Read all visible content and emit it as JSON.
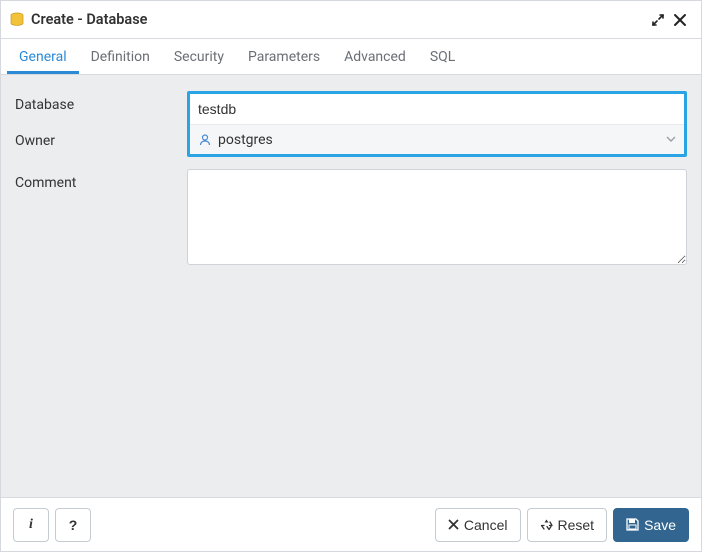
{
  "header": {
    "title": "Create - Database"
  },
  "tabs": [
    {
      "label": "General",
      "active": true
    },
    {
      "label": "Definition",
      "active": false
    },
    {
      "label": "Security",
      "active": false
    },
    {
      "label": "Parameters",
      "active": false
    },
    {
      "label": "Advanced",
      "active": false
    },
    {
      "label": "SQL",
      "active": false
    }
  ],
  "form": {
    "database": {
      "label": "Database",
      "value": "testdb"
    },
    "owner": {
      "label": "Owner",
      "value": "postgres"
    },
    "comment": {
      "label": "Comment",
      "value": ""
    }
  },
  "footer": {
    "info_label": "i",
    "help_label": "?",
    "cancel_label": "Cancel",
    "reset_label": "Reset",
    "save_label": "Save"
  },
  "icons": {
    "database": "database-icon",
    "expand": "expand-icon",
    "close": "close-icon",
    "user": "user-icon",
    "caret": "caret-down-icon",
    "cancel_x": "x-icon",
    "reset_recycle": "recycle-icon",
    "save_disk": "save-icon"
  }
}
